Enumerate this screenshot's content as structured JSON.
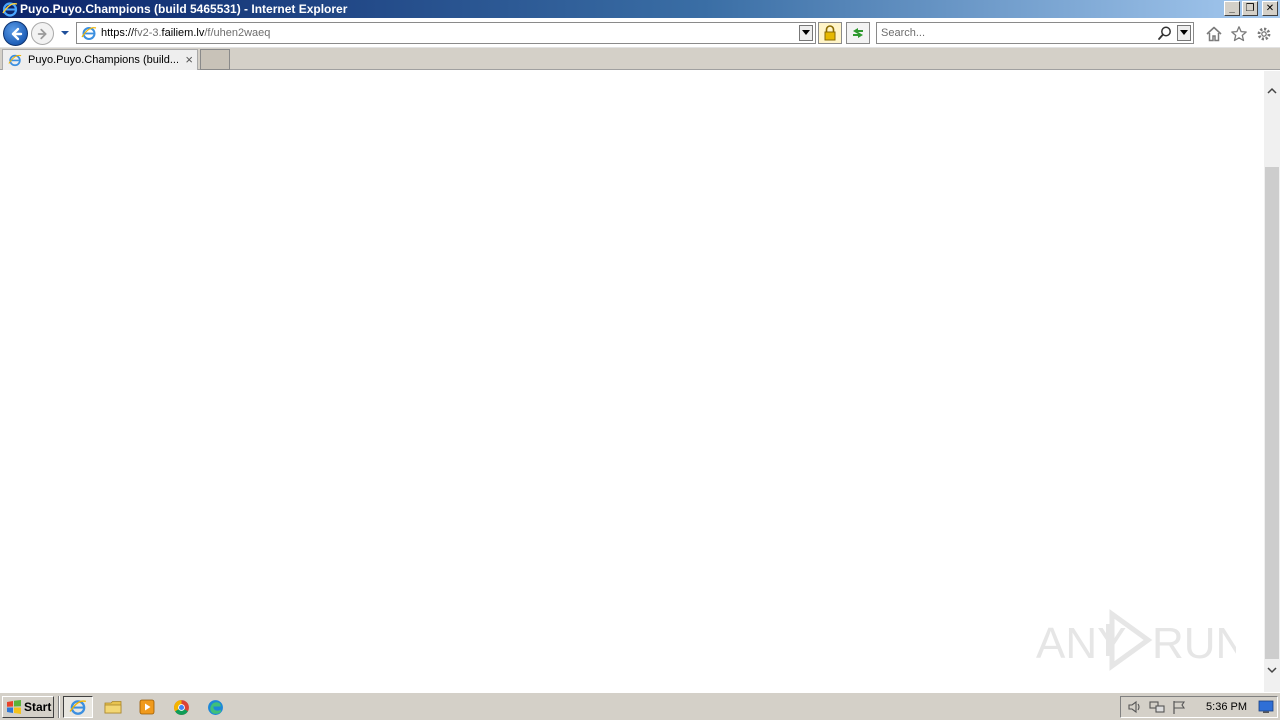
{
  "window": {
    "title": "Puyo.Puyo.Champions (build 5465531) - Internet Explorer",
    "controls": {
      "minimize": "_",
      "restore": "❐",
      "close": "✕"
    }
  },
  "navigation": {
    "url_protocol": "https://",
    "url_subdomain": "fv2-3.",
    "url_domain": "failiem.lv",
    "url_path": "/f/uhen2waeq",
    "search_placeholder": "Search..."
  },
  "tabs": [
    {
      "label": "Puyo.Puyo.Champions (build...",
      "close": "×"
    }
  ],
  "taskbar": {
    "start_label": "Start",
    "clock": "5:36 PM",
    "apps": [
      "internet-explorer",
      "file-explorer",
      "media-player",
      "chrome",
      "edge"
    ]
  },
  "watermark": {
    "text": "ANY RUN"
  },
  "colors": {
    "titlebar_start": "#0a246a",
    "titlebar_end": "#a6caf0",
    "chrome_gray": "#d4d0c8"
  }
}
